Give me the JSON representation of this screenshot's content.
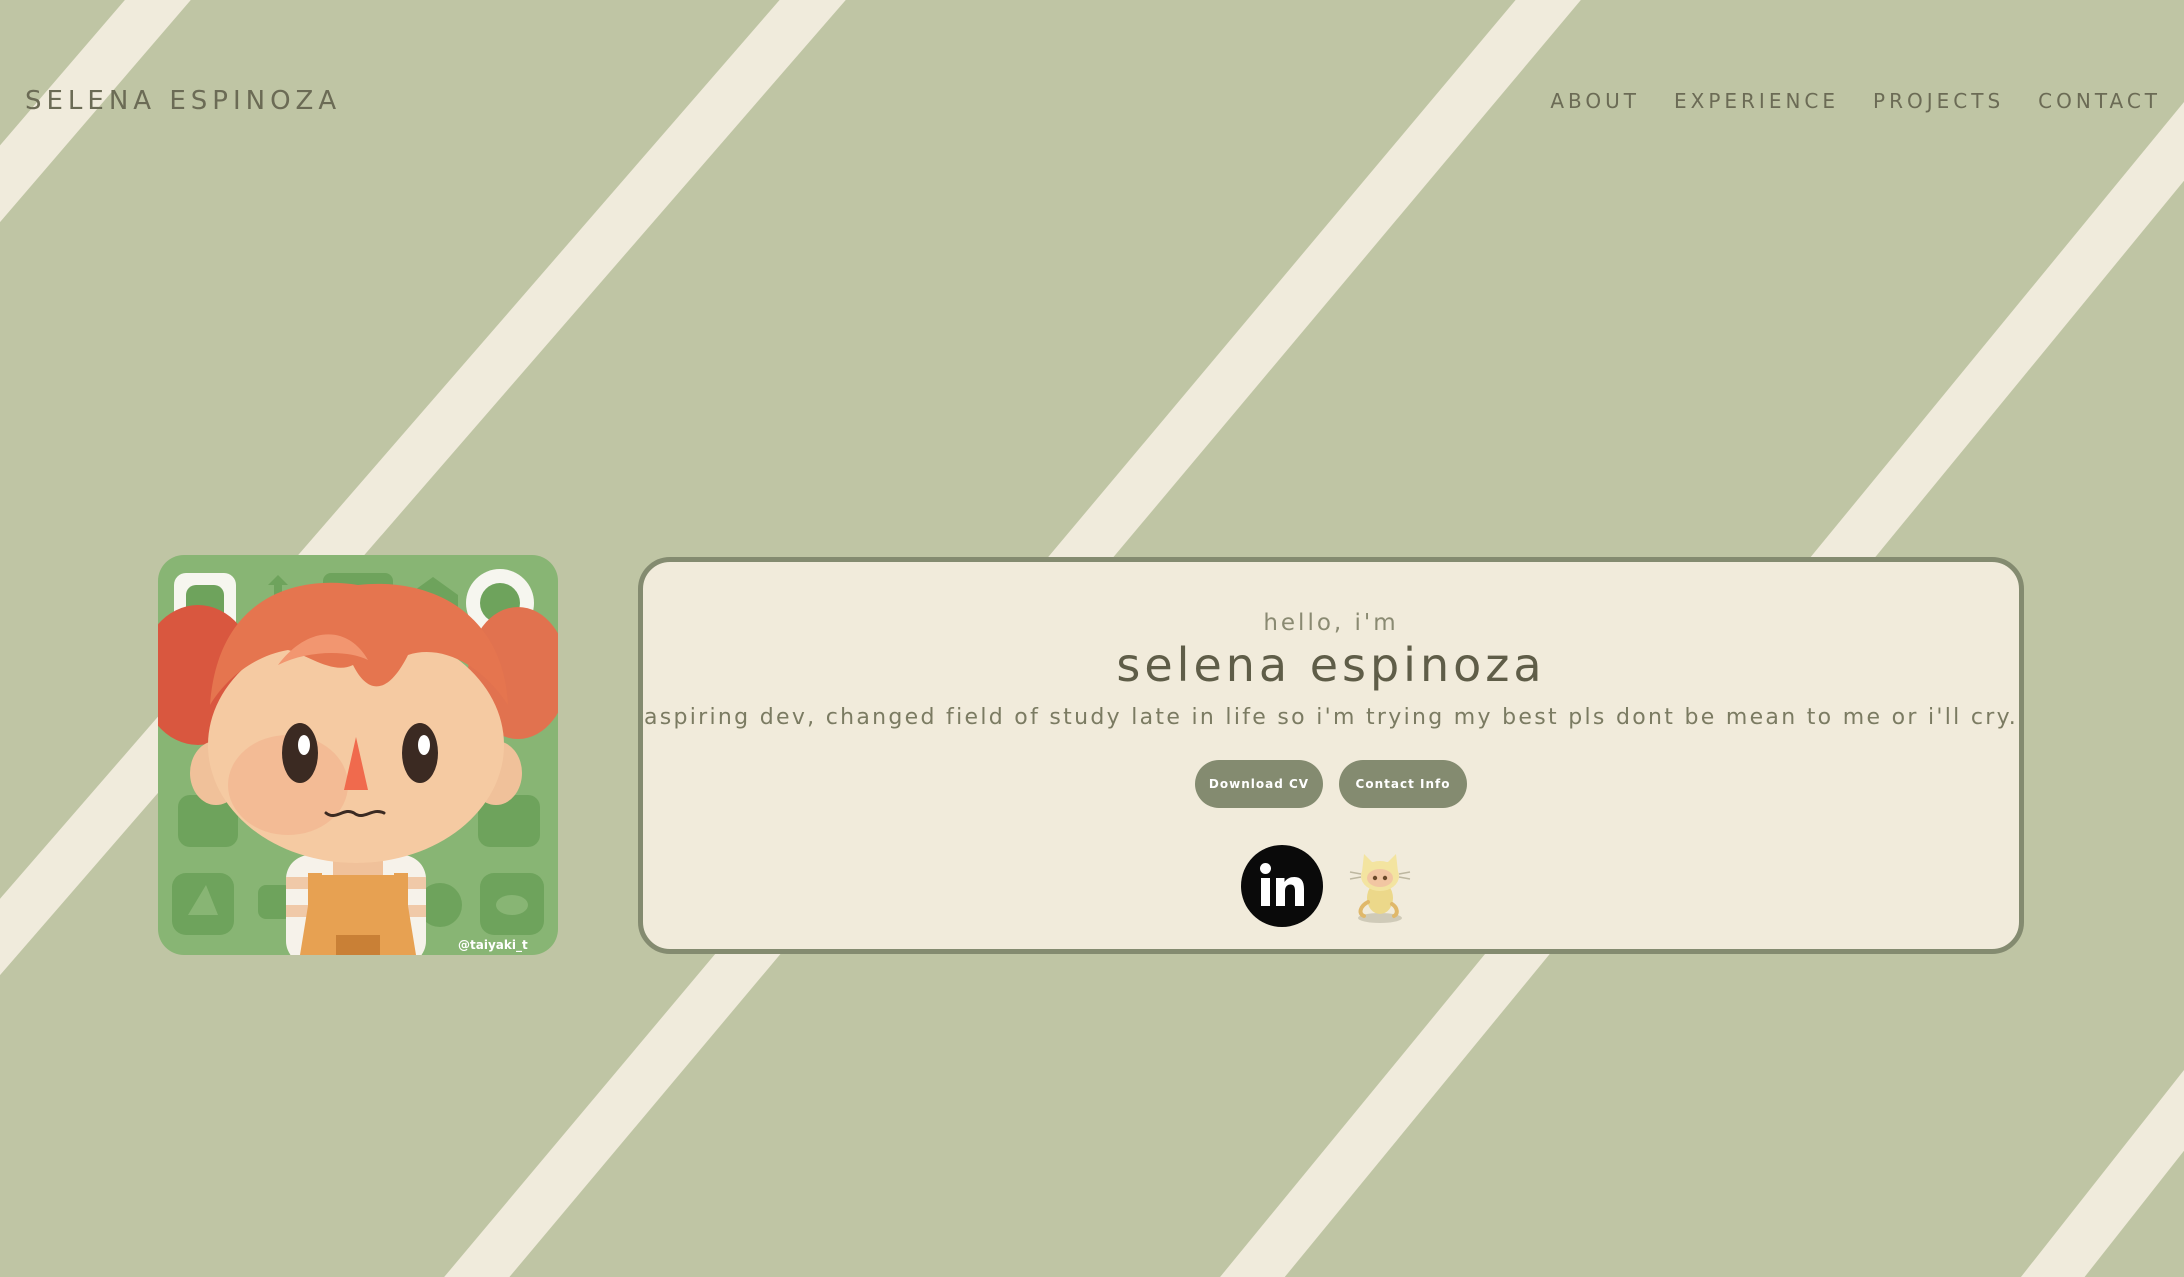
{
  "header": {
    "brand": "SELENA ESPINOZA",
    "nav": [
      "ABOUT",
      "EXPERIENCE",
      "PROJECTS",
      "CONTACT"
    ]
  },
  "avatar": {
    "credit": "@taiyaki_t"
  },
  "intro": {
    "greeting": "hello, i'm",
    "name": "selena espinoza",
    "tagline": "aspiring dev, changed field of study late in life so i'm trying my best pls dont be mean to me or i'll cry.",
    "buttons": {
      "download": "Download CV",
      "contact": "Contact Info"
    }
  },
  "socials": {
    "linkedin_icon": "linkedin-icon",
    "github_icon": "github-octocat-icon"
  },
  "colors": {
    "background": "#bfc5a4",
    "stripe": "#f0ebdc",
    "card": "#f1ebdb",
    "accent": "#848b70",
    "text": "#6b6b55"
  }
}
